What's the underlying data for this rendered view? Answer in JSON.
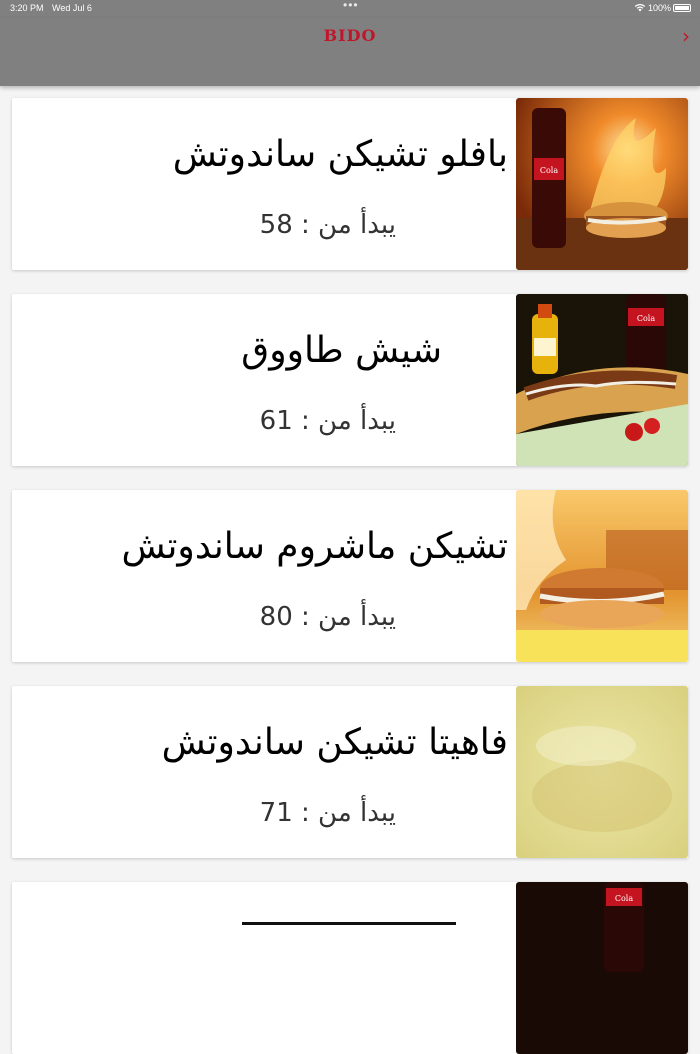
{
  "status": {
    "time": "3:20 PM",
    "date": "Wed Jul 6",
    "battery": "100%"
  },
  "nav": {
    "brand": "BIDO",
    "brand_color": "#c0162b",
    "forward_icon": "chevron-right-icon"
  },
  "items": [
    {
      "title": "بافلو تشيكن ساندوتش",
      "price_prefix": "يبدأ من :",
      "price": "58"
    },
    {
      "title": "شيش طاووق",
      "price_prefix": "يبدأ من :",
      "price": "61"
    },
    {
      "title": "تشيكن ماشروم ساندوتش",
      "price_prefix": "يبدأ من :",
      "price": "80"
    },
    {
      "title": "فاهيتا تشيكن ساندوتش",
      "price_prefix": "يبدأ من :",
      "price": "71"
    }
  ]
}
